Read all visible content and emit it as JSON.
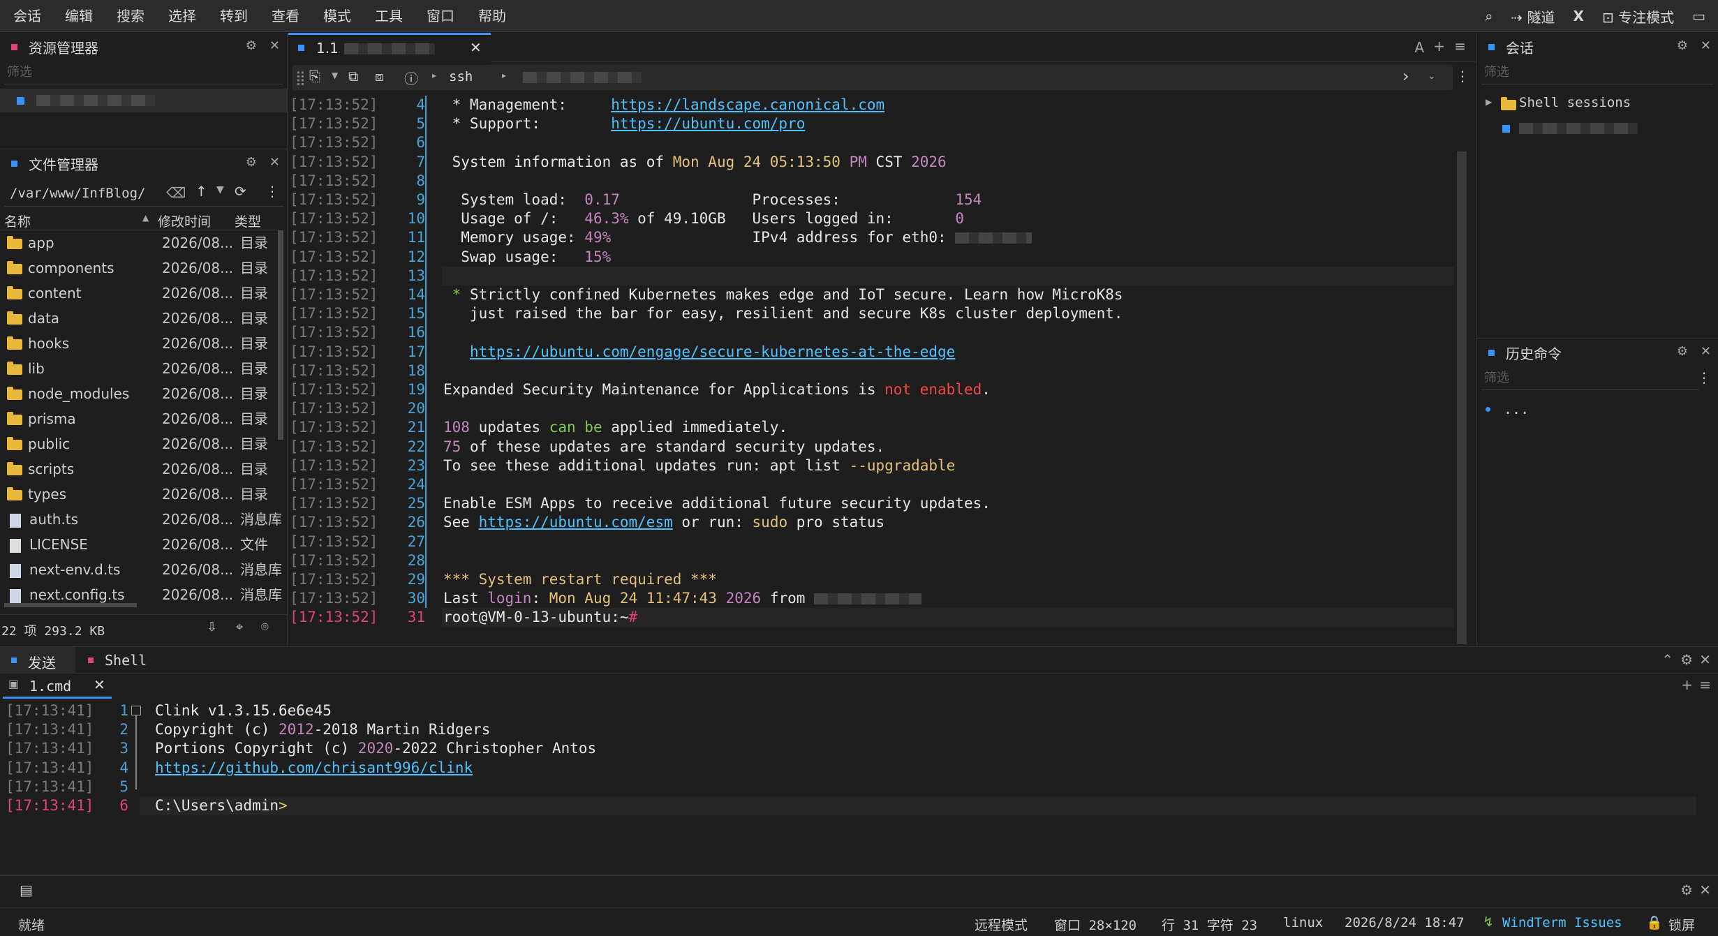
{
  "menu": [
    "会话",
    "编辑",
    "搜索",
    "选择",
    "转到",
    "查看",
    "模式",
    "工具",
    "窗口",
    "帮助"
  ],
  "menu_right": {
    "tunnel": "隧道",
    "focus": "专注模式"
  },
  "resource_panel": {
    "title": "资源管理器",
    "filter_placeholder": "筛选"
  },
  "file_panel": {
    "title": "文件管理器",
    "path": "/var/www/InfBlog/",
    "columns": {
      "name": "名称",
      "mtime": "修改时间",
      "type": "类型"
    },
    "rows": [
      {
        "name": "app",
        "date": "2026/08...",
        "type": "目录",
        "kind": "folder"
      },
      {
        "name": "components",
        "date": "2026/08...",
        "type": "目录",
        "kind": "folder"
      },
      {
        "name": "content",
        "date": "2026/08...",
        "type": "目录",
        "kind": "folder"
      },
      {
        "name": "data",
        "date": "2026/08...",
        "type": "目录",
        "kind": "folder"
      },
      {
        "name": "hooks",
        "date": "2026/08...",
        "type": "目录",
        "kind": "folder"
      },
      {
        "name": "lib",
        "date": "2026/08...",
        "type": "目录",
        "kind": "folder"
      },
      {
        "name": "node_modules",
        "date": "2026/08...",
        "type": "目录",
        "kind": "folder"
      },
      {
        "name": "prisma",
        "date": "2026/08...",
        "type": "目录",
        "kind": "folder"
      },
      {
        "name": "public",
        "date": "2026/08...",
        "type": "目录",
        "kind": "folder"
      },
      {
        "name": "scripts",
        "date": "2026/08...",
        "type": "目录",
        "kind": "folder"
      },
      {
        "name": "types",
        "date": "2026/08...",
        "type": "目录",
        "kind": "folder"
      },
      {
        "name": "auth.ts",
        "date": "2026/08...",
        "type": "消息库",
        "kind": "ts"
      },
      {
        "name": "LICENSE",
        "date": "2026/08...",
        "type": "文件",
        "kind": "file"
      },
      {
        "name": "next-env.d.ts",
        "date": "2026/08...",
        "type": "消息库",
        "kind": "ts"
      },
      {
        "name": "next.config.ts",
        "date": "2026/08...",
        "type": "消息库",
        "kind": "ts"
      }
    ],
    "summary": "22 项 293.2 KB"
  },
  "editor": {
    "tab_label": "1.1",
    "toolbar_ssh": "ssh",
    "title_right": "A"
  },
  "terminal": {
    "timestamp": "[17:13:52]",
    "lines": [
      {
        "n": "4",
        "segs": [
          [
            " * Management:     ",
            ""
          ],
          [
            "https://landscape.canonical.com",
            "link"
          ]
        ]
      },
      {
        "n": "5",
        "segs": [
          [
            " * Support:        ",
            ""
          ],
          [
            "https://ubuntu.com/pro",
            "link"
          ]
        ]
      },
      {
        "n": "6",
        "segs": []
      },
      {
        "n": "7",
        "segs": [
          [
            " System information as of ",
            ""
          ],
          [
            "Mon Aug 24 05:13:50",
            "yellow"
          ],
          [
            " ",
            ""
          ],
          [
            "PM",
            "purple"
          ],
          [
            " CST ",
            ""
          ],
          [
            "2026",
            "purple"
          ]
        ]
      },
      {
        "n": "8",
        "segs": []
      },
      {
        "n": "9",
        "segs": [
          [
            "  System load:  ",
            ""
          ],
          [
            "0.17",
            "purple"
          ],
          [
            "               Processes:             ",
            ""
          ],
          [
            "154",
            "purple"
          ]
        ]
      },
      {
        "n": "10",
        "segs": [
          [
            "  Usage of /:   ",
            ""
          ],
          [
            "46.3%",
            "purple"
          ],
          [
            " of 49.10GB   Users logged in:       ",
            ""
          ],
          [
            "0",
            "purple"
          ]
        ]
      },
      {
        "n": "11",
        "segs": [
          [
            "  Memory usage: ",
            ""
          ],
          [
            "49%",
            "purple"
          ],
          [
            "                IPv4 address for eth0: ",
            ""
          ],
          [
            "██████████",
            "blur"
          ]
        ]
      },
      {
        "n": "12",
        "segs": [
          [
            "  Swap usage:   ",
            ""
          ],
          [
            "15%",
            "purple"
          ]
        ]
      },
      {
        "n": "13",
        "segs": []
      },
      {
        "n": "14",
        "segs": [
          [
            " * ",
            "green"
          ],
          [
            "Strictly confined Kubernetes makes edge and IoT secure. Learn how MicroK8s",
            ""
          ]
        ]
      },
      {
        "n": "15",
        "segs": [
          [
            "   just raised the bar for easy, resilient and secure K8s cluster deployment.",
            ""
          ]
        ]
      },
      {
        "n": "16",
        "segs": []
      },
      {
        "n": "17",
        "segs": [
          [
            "   ",
            ""
          ],
          [
            "https://ubuntu.com/engage/secure-kubernetes-at-the-edge",
            "link"
          ]
        ]
      },
      {
        "n": "18",
        "segs": []
      },
      {
        "n": "19",
        "segs": [
          [
            "Expanded Security Maintenance for Applications is ",
            ""
          ],
          [
            "not enabled",
            "red"
          ],
          [
            ".",
            ""
          ]
        ]
      },
      {
        "n": "20",
        "segs": []
      },
      {
        "n": "21",
        "segs": [
          [
            "108",
            "purple"
          ],
          [
            " updates ",
            ""
          ],
          [
            "can be",
            "green"
          ],
          [
            " applied immediately.",
            ""
          ]
        ]
      },
      {
        "n": "22",
        "segs": [
          [
            "75",
            "purple"
          ],
          [
            " of these updates are standard security updates.",
            ""
          ]
        ]
      },
      {
        "n": "23",
        "segs": [
          [
            "To see these additional updates run: apt list ",
            ""
          ],
          [
            "--upgradable",
            "yellow"
          ]
        ]
      },
      {
        "n": "24",
        "segs": []
      },
      {
        "n": "25",
        "segs": [
          [
            "Enable ESM Apps to receive additional future security updates.",
            ""
          ]
        ]
      },
      {
        "n": "26",
        "segs": [
          [
            "See ",
            ""
          ],
          [
            "https://ubuntu.com/esm",
            "link"
          ],
          [
            " or run: ",
            ""
          ],
          [
            "sudo",
            "yellow"
          ],
          [
            " pro status",
            ""
          ]
        ]
      },
      {
        "n": "27",
        "segs": []
      },
      {
        "n": "28",
        "segs": []
      },
      {
        "n": "29",
        "segs": [
          [
            "*** System restart required ***",
            "yellow"
          ]
        ]
      },
      {
        "n": "30",
        "segs": [
          [
            "Last ",
            ""
          ],
          [
            "login",
            "purple"
          ],
          [
            ": ",
            ""
          ],
          [
            "Mon Aug 24 11:47:43",
            "yellow"
          ],
          [
            " ",
            ""
          ],
          [
            "2026",
            "purple"
          ],
          [
            " from ",
            ""
          ],
          [
            "██████████████",
            "blur"
          ]
        ]
      },
      {
        "n": "31",
        "segs": [
          [
            "root@VM-0-13-ubuntu:~",
            ""
          ],
          [
            "#",
            "mag"
          ]
        ]
      }
    ]
  },
  "session_panel": {
    "title": "会话",
    "filter_placeholder": "筛选",
    "group": "Shell sessions"
  },
  "history_panel": {
    "title": "历史命令",
    "filter_placeholder": "筛选",
    "item": "..."
  },
  "bottom": {
    "tabs": [
      "发送",
      "Shell"
    ],
    "subtab": "1.cmd",
    "timestamp": "[17:13:41]",
    "lines": [
      {
        "n": "1",
        "segs": [
          [
            "Clink v1.3.15.6e6e45",
            ""
          ]
        ]
      },
      {
        "n": "2",
        "segs": [
          [
            "Copyright (c) ",
            ""
          ],
          [
            "2012",
            "purple"
          ],
          [
            "-2018 Martin Ridgers",
            ""
          ]
        ]
      },
      {
        "n": "3",
        "segs": [
          [
            "Portions Copyright (c) ",
            ""
          ],
          [
            "2020",
            "purple"
          ],
          [
            "-2022 Christopher Antos",
            ""
          ]
        ]
      },
      {
        "n": "4",
        "segs": [
          [
            "https://github.com/chrisant996/clink",
            "link"
          ]
        ]
      },
      {
        "n": "5",
        "segs": []
      },
      {
        "n": "6",
        "segs": [
          [
            "C:\\Users\\admin",
            ""
          ],
          [
            ">",
            "yellow"
          ]
        ]
      }
    ]
  },
  "status": {
    "ready": "就绪",
    "remote_mode": "远程模式",
    "window": "窗口 28×120",
    "position": "行 31 字符 23",
    "os": "linux",
    "datetime": "2026/8/24 18:47",
    "issues": "WindTerm Issues",
    "lock": "锁屏"
  }
}
